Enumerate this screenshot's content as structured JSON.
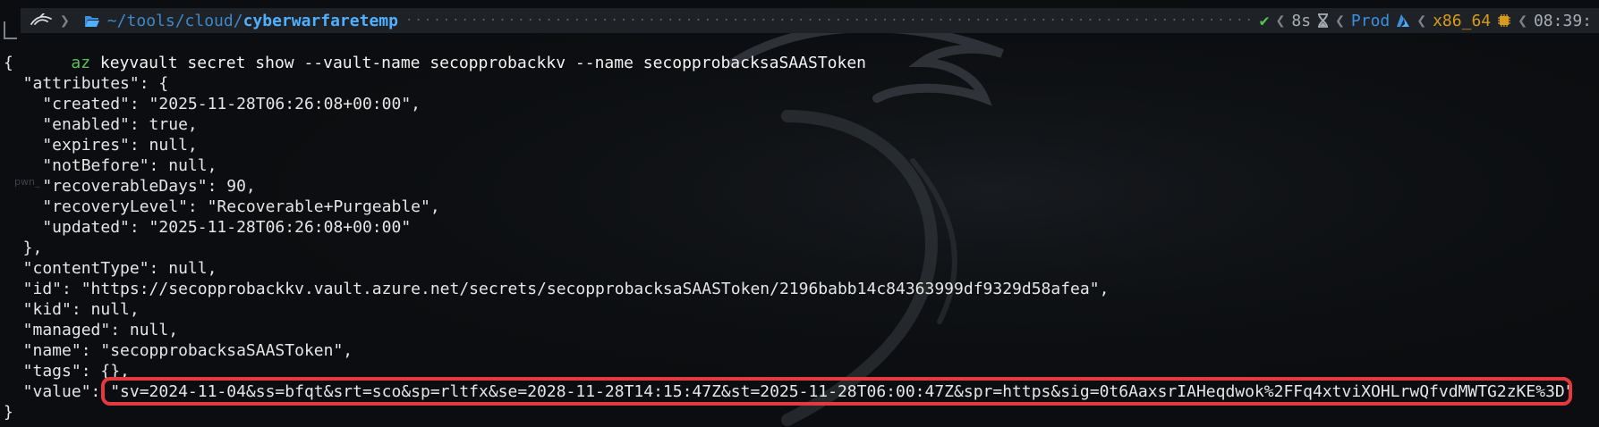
{
  "prompt": {
    "path_prefix": "~/tools/cloud/",
    "path_current": "cyberwarfaretemp",
    "status_icon": "check-icon",
    "status_mark": "✔",
    "duration": "8s",
    "environment": "Prod",
    "arch": "x86_64",
    "time": "08:39:"
  },
  "command": {
    "program": "az",
    "args": " keyvault secret show --vault-name secopprobackkv --name secopprobacksaSAASToken"
  },
  "output_lines": [
    "{",
    "  \"attributes\": {",
    "    \"created\": \"2025-11-28T06:26:08+00:00\",",
    "    \"enabled\": true,",
    "    \"expires\": null,",
    "    \"notBefore\": null,",
    "    \"recoverableDays\": 90,",
    "    \"recoveryLevel\": \"Recoverable+Purgeable\",",
    "    \"updated\": \"2025-11-28T06:26:08+00:00\"",
    "  },",
    "  \"contentType\": null,",
    "  \"id\": \"https://secopprobackkv.vault.azure.net/secrets/secopprobacksaSAASToken/2196babb14c84363999df9329d58afea\",",
    "  \"kid\": null,",
    "  \"managed\": null,",
    "  \"name\": \"secopprobacksaSAASToken\",",
    "  \"tags\": {},",
    "  \"value\": \"sv=2024-11-04&ss=bfqt&srt=sco&sp=rltfx&se=2028-11-28T14:15:47Z&st=2025-11-28T06:00:47Z&spr=https&sig=0t6AaxsrIAHeqdwok%2FFq4xtviXOHLrwQfvdMWTG2zKE%3D\"",
    "}"
  ],
  "desktop_ghost_labels": [
    "pwn_"
  ],
  "colors": {
    "background": "#0b0d10",
    "highlight": "#e43a3f",
    "prompt_bar": "#1e2227",
    "path": "#4fb0ff",
    "ok": "#59c156",
    "arch": "#d79b1f"
  }
}
